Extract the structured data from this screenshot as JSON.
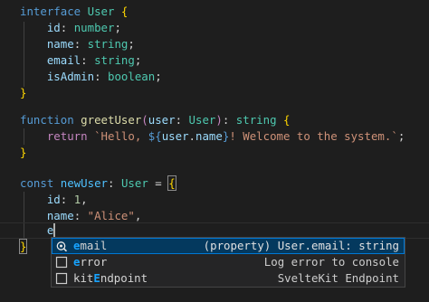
{
  "editor": {
    "lines": {
      "l1": {
        "kw": "interface",
        "name": "User",
        "open": "{"
      },
      "l2": {
        "prop": "id",
        "colon": ":",
        "type": "number",
        "semi": ";"
      },
      "l3": {
        "prop": "name",
        "colon": ":",
        "type": "string",
        "semi": ";"
      },
      "l4": {
        "prop": "email",
        "colon": ":",
        "type": "string",
        "semi": ";"
      },
      "l5": {
        "prop": "isAdmin",
        "colon": ":",
        "type": "boolean",
        "semi": ";"
      },
      "l6": {
        "close": "}"
      },
      "l8": {
        "kw": "function",
        "fn": "greetUser",
        "paren_open": "(",
        "param": "user",
        "colon": ":",
        "ptype": "User",
        "paren_close": ")",
        "colon2": ":",
        "rtype": "string",
        "open": "{"
      },
      "l9": {
        "kw": "return",
        "tick": "`",
        "text1": "Hello, ",
        "interp_open": "${",
        "obj": "user",
        "dot": ".",
        "field": "name",
        "interp_close": "}",
        "text2": "! Welcome to the system.",
        "tick_end": "`",
        "semi": ";"
      },
      "l10": {
        "close": "}"
      },
      "l12": {
        "kw": "const",
        "var": "newUser",
        "colon": ":",
        "type": "User",
        "eq": "=",
        "open": "{"
      },
      "l13": {
        "prop": "id",
        "colon": ":",
        "value": "1",
        "comma": ","
      },
      "l14": {
        "prop": "name",
        "colon": ":",
        "value": "\"Alice\"",
        "comma": ","
      },
      "l15": {
        "typed": "e"
      },
      "l16": {
        "close": "}"
      }
    }
  },
  "suggest": {
    "items": [
      {
        "match": "e",
        "rest": "mail",
        "detail": "(property) User.email: string",
        "icon": "property-icon"
      },
      {
        "match": "e",
        "rest": "rror",
        "detail": "Log error to console",
        "icon": "snippet-icon"
      },
      {
        "pre": "kit",
        "match": "E",
        "rest": "ndpoint",
        "detail": "SvelteKit Endpoint",
        "icon": "snippet-icon"
      }
    ]
  },
  "colors": {
    "background": "#1e1e1e",
    "keyword": "#569cd6",
    "type": "#4ec9b0",
    "property": "#9cdcfe",
    "function": "#dcdcaa",
    "string": "#ce9178",
    "number": "#b5cea8",
    "bracket": "#ffd700",
    "selection": "#04395e",
    "match_highlight": "#18a3ff"
  }
}
